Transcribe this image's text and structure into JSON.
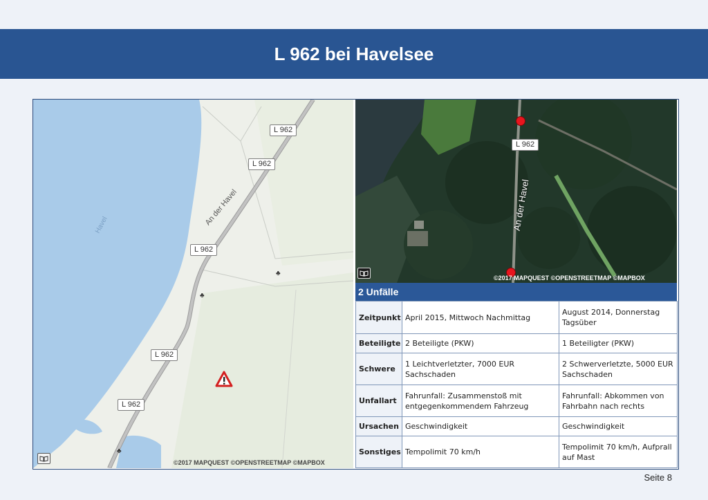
{
  "slide": {
    "title": "L 962 bei Havelsee",
    "page_label": "Seite 8"
  },
  "map_left": {
    "road_labels": [
      "L 962",
      "L 962",
      "L 962",
      "L 962",
      "L 962"
    ],
    "street_name": "An der Havel",
    "lake_name": "Havel",
    "attribution": "©2017 MAPQUEST ©OPENSTREETMAP ©MAPBOX",
    "icons": [
      "warning-triangle-icon",
      "tree-icon",
      "tree-icon",
      "tree-icon",
      "map-book-icon"
    ],
    "colors": {
      "water": "#a9cbe9",
      "road": "#b5b5b5",
      "land": "#eef0ea",
      "warning": "#d32020"
    }
  },
  "map_right": {
    "road_label": "L 962",
    "street_name": "An der Havel",
    "attribution": "©2017 MAPQUEST ©OPENSTREETMAP ©MAPBOX",
    "marker_color": "#e8151e"
  },
  "accidents": {
    "header": "2 Unfälle",
    "rows": [
      {
        "label": "Zeitpunkt",
        "a": "April 2015, Mittwoch Nachmittag",
        "b": "August 2014, Donnerstag Tagsüber"
      },
      {
        "label": "Beteiligte",
        "a": "2 Beteiligte (PKW)",
        "b": "1 Beteiligter (PKW)"
      },
      {
        "label": "Schwere",
        "a": "1 Leichtverletzter, 7000 EUR Sachschaden",
        "b": "2 Schwerverletzte, 5000 EUR Sachschaden"
      },
      {
        "label": "Unfallart",
        "a": "Fahrunfall: Zusammenstoß mit entgegenkommendem Fahrzeug",
        "b": "Fahrunfall: Abkommen von Fahrbahn nach rechts"
      },
      {
        "label": "Ursachen",
        "a": "Geschwindigkeit",
        "b": "Geschwindigkeit"
      },
      {
        "label": "Sonstiges",
        "a": "Tempolimit 70 km/h",
        "b": "Tempolimit 70 km/h, Aufprall auf Mast"
      }
    ],
    "colors": {
      "header_bg": "#2b5898",
      "border": "#7f96b8"
    }
  }
}
